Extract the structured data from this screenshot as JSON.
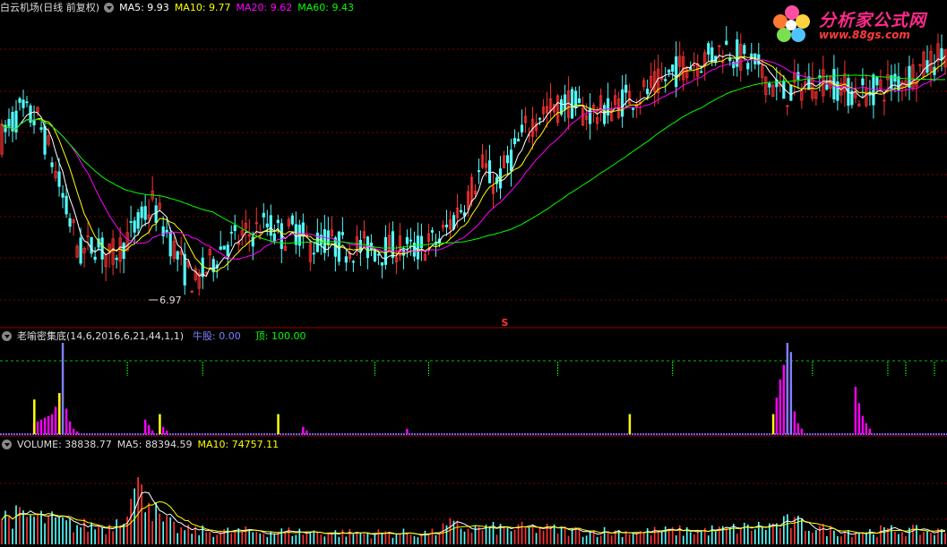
{
  "header_main": {
    "title": "白云机场(日线 前复权)",
    "ma5": "MA5: 9.93",
    "ma10": "MA10: 9.77",
    "ma20": "MA20: 9.62",
    "ma60": "MA60: 9.43"
  },
  "header_ind": {
    "title": "老喻密集底(14,6,2016,6,21,44,1,1)",
    "niugu": "牛股: 0.00",
    "ding": "顶: 100.00"
  },
  "header_vol": {
    "volume": "VOLUME: 38838.77",
    "ma5": "MA5: 88394.59",
    "ma10": "MA10: 74757.11"
  },
  "low_label": "6.97",
  "signal_label": "S",
  "logo": {
    "title": "分析家公式网",
    "url": "www.88gs.com"
  },
  "colors": {
    "up": "#ff3232",
    "down": "#54fcfc",
    "ma5": "#ffffff",
    "ma10": "#ffff00",
    "ma20": "#ff00ff",
    "ma60": "#00ff00",
    "pink_bar": "#ff00ff",
    "blue_bar": "#8080ff",
    "yellow_bar": "#ffff00",
    "grid": "#7a0000"
  },
  "chart_data": [
    {
      "type": "candlestick",
      "title": "白云机场(日线 前复权)",
      "price_anchors": [
        [
          0,
          9.2
        ],
        [
          5,
          9.55
        ],
        [
          10,
          9.45
        ],
        [
          14,
          8.9
        ],
        [
          18,
          8.2
        ],
        [
          22,
          7.6
        ],
        [
          26,
          7.75
        ],
        [
          30,
          7.55
        ],
        [
          34,
          7.75
        ],
        [
          38,
          8.0
        ],
        [
          42,
          8.3
        ],
        [
          46,
          7.9
        ],
        [
          50,
          7.45
        ],
        [
          54,
          7.2
        ],
        [
          58,
          7.45
        ],
        [
          62,
          7.75
        ],
        [
          66,
          7.8
        ],
        [
          70,
          7.9
        ],
        [
          74,
          8.0
        ],
        [
          78,
          7.85
        ],
        [
          82,
          7.95
        ],
        [
          86,
          7.7
        ],
        [
          90,
          7.8
        ],
        [
          94,
          7.7
        ],
        [
          98,
          7.7
        ],
        [
          102,
          7.7
        ],
        [
          106,
          7.65
        ],
        [
          110,
          7.7
        ],
        [
          114,
          7.65
        ],
        [
          118,
          7.72
        ],
        [
          122,
          7.8
        ],
        [
          126,
          8.1
        ],
        [
          130,
          8.4
        ],
        [
          134,
          8.8
        ],
        [
          138,
          8.55
        ],
        [
          142,
          8.95
        ],
        [
          146,
          9.3
        ],
        [
          150,
          9.55
        ],
        [
          154,
          9.6
        ],
        [
          158,
          9.7
        ],
        [
          162,
          9.55
        ],
        [
          166,
          9.55
        ],
        [
          170,
          9.6
        ],
        [
          174,
          9.75
        ],
        [
          178,
          9.8
        ],
        [
          182,
          9.9
        ],
        [
          186,
          10.05
        ],
        [
          190,
          10.2
        ],
        [
          194,
          10.25
        ],
        [
          198,
          10.35
        ],
        [
          202,
          10.45
        ],
        [
          206,
          10.3
        ],
        [
          210,
          10.2
        ],
        [
          214,
          9.95
        ],
        [
          218,
          9.8
        ],
        [
          222,
          9.9
        ],
        [
          226,
          9.95
        ],
        [
          230,
          10.0
        ],
        [
          234,
          9.9
        ],
        [
          238,
          9.8
        ],
        [
          242,
          9.85
        ],
        [
          246,
          9.9
        ],
        [
          250,
          10.0
        ],
        [
          254,
          10.1
        ],
        [
          258,
          10.2
        ],
        [
          262,
          10.35
        ],
        [
          263,
          10.4
        ]
      ],
      "ma5": 9.93,
      "ma10": 9.77,
      "ma20": 9.62,
      "ma60": 9.43,
      "low": 6.97,
      "ylim": [
        6.6,
        10.9
      ],
      "bars": 264
    },
    {
      "type": "bar",
      "title": "老喻密集底(14,6,2016,6,21,44,1,1)",
      "niugu": 0.0,
      "ding": 100.0,
      "ylim": [
        0,
        100
      ],
      "pink_bars": [
        [
          9,
          12
        ],
        [
          10,
          14
        ],
        [
          11,
          16
        ],
        [
          12,
          18
        ],
        [
          13,
          20
        ],
        [
          14,
          22
        ],
        [
          15,
          30
        ],
        [
          16,
          45
        ],
        [
          18,
          28
        ],
        [
          19,
          14
        ],
        [
          20,
          6
        ],
        [
          21,
          3
        ],
        [
          40,
          16
        ],
        [
          41,
          10
        ],
        [
          42,
          4
        ],
        [
          45,
          8
        ],
        [
          46,
          4
        ],
        [
          84,
          8
        ],
        [
          85,
          4
        ],
        [
          113,
          6
        ],
        [
          216,
          40
        ],
        [
          217,
          60
        ],
        [
          218,
          76
        ],
        [
          219,
          80
        ],
        [
          220,
          55
        ],
        [
          221,
          25
        ],
        [
          222,
          12
        ],
        [
          223,
          6
        ],
        [
          238,
          52
        ],
        [
          239,
          34
        ],
        [
          240,
          20
        ],
        [
          241,
          12
        ],
        [
          242,
          6
        ]
      ],
      "blue_bars": [
        [
          17,
          100
        ],
        [
          219,
          100
        ],
        [
          220,
          90
        ]
      ],
      "yellow_bars": [
        [
          9,
          38
        ],
        [
          16,
          45
        ],
        [
          44,
          22
        ],
        [
          77,
          22
        ],
        [
          175,
          22
        ],
        [
          215,
          22
        ]
      ],
      "top_markers": [
        35,
        56,
        104,
        119,
        155,
        187,
        226,
        247,
        252,
        260
      ]
    },
    {
      "type": "bar",
      "title": "VOLUME",
      "volume": 38838.77,
      "ma5": 88394.59,
      "ma10": 74757.11,
      "ylim": [
        0,
        300000
      ],
      "volume_anchors": [
        [
          0,
          90000
        ],
        [
          10,
          85000
        ],
        [
          20,
          60000
        ],
        [
          30,
          55000
        ],
        [
          38,
          165000
        ],
        [
          39,
          260000
        ],
        [
          40,
          170000
        ],
        [
          44,
          75000
        ],
        [
          50,
          45000
        ],
        [
          60,
          40000
        ],
        [
          80,
          40000
        ],
        [
          100,
          35000
        ],
        [
          120,
          35000
        ],
        [
          125,
          60000
        ],
        [
          130,
          50000
        ],
        [
          140,
          50000
        ],
        [
          150,
          50000
        ],
        [
          160,
          42000
        ],
        [
          180,
          40000
        ],
        [
          200,
          45000
        ],
        [
          215,
          60000
        ],
        [
          220,
          70000
        ],
        [
          230,
          45000
        ],
        [
          240,
          40000
        ],
        [
          250,
          45000
        ],
        [
          263,
          38838.77
        ]
      ]
    }
  ]
}
